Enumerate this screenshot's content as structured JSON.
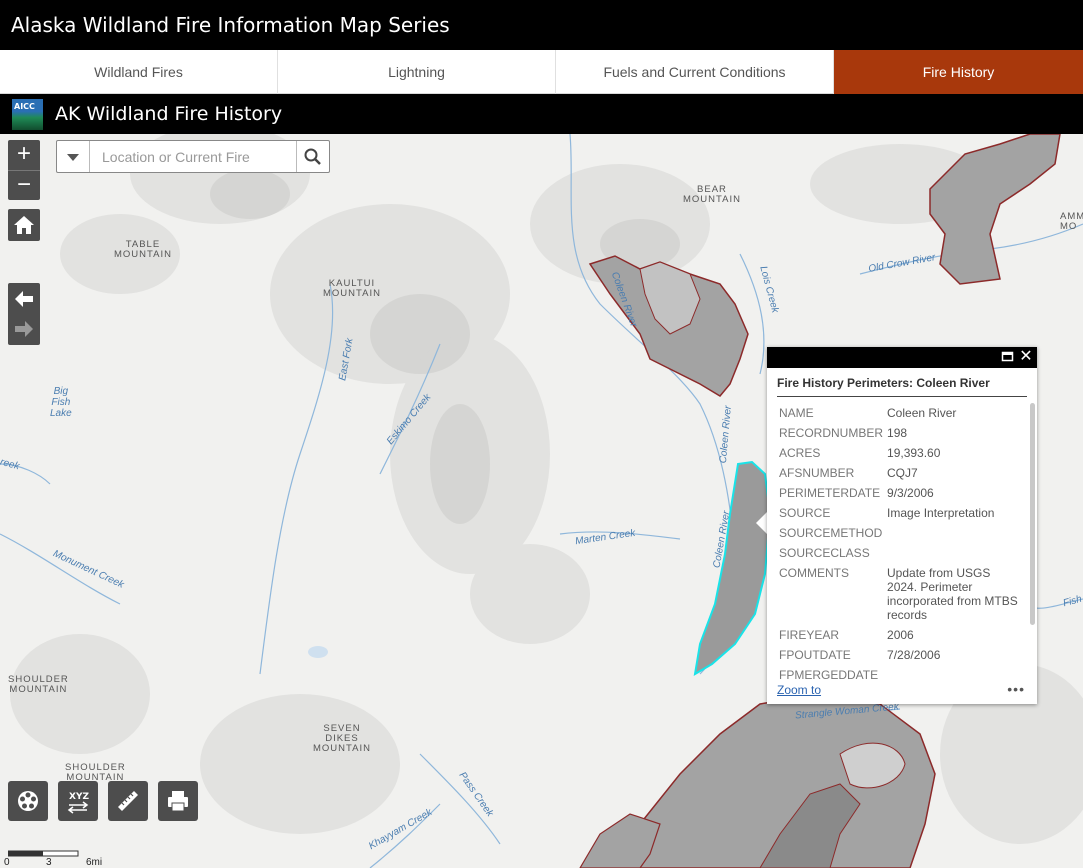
{
  "header": {
    "title": "Alaska Wildland Fire Information Map Series"
  },
  "tabs": [
    {
      "label": "Wildland Fires",
      "active": false
    },
    {
      "label": "Lightning",
      "active": false
    },
    {
      "label": "Fuels and Current Conditions",
      "active": false
    },
    {
      "label": "Fire History",
      "active": true
    }
  ],
  "app": {
    "logo_text": "AICC",
    "title": "AK Wildland Fire History"
  },
  "search": {
    "placeholder": "Location or Current Fire",
    "value": ""
  },
  "zoom": {
    "in": "+",
    "out": "−"
  },
  "map_labels": {
    "bear_mountain": [
      "BEAR",
      "MOUNTAIN"
    ],
    "table_mountain": [
      "TABLE",
      "MOUNTAIN"
    ],
    "kaultui_mountain": [
      "KAULTUI",
      "MOUNTAIN"
    ],
    "shoulder_mountain_1": [
      "SHOULDER",
      "MOUNTAIN"
    ],
    "shoulder_mountain_2": [
      "SHOULDER",
      "MOUNTAIN"
    ],
    "seven_dikes_mountain": [
      "SEVEN",
      "DIKES",
      "MOUNTAIN"
    ],
    "big_fish_lake": [
      "Big",
      "Fish",
      "Lake"
    ],
    "am_mo": [
      "AMM",
      "MO"
    ],
    "water": {
      "old_crow_river": "Old Crow River",
      "lois_creek": "Lois Creek",
      "coleen_river_1": "Coleen River",
      "coleen_river_2": "Coleen River",
      "coleen_river_3": "Coleen River",
      "east_fork": "East Fork",
      "eskimo_creek": "Eskimo Creek",
      "marten_creek": "Marten Creek",
      "monument_creek": "Monument Creek",
      "pass_creek": "Pass Creek",
      "khayyam_creek": "Khayyam Creek",
      "strangle_woman_creek": "Strangle Woman Creek",
      "fish": "Fish",
      "creek_left": "reek"
    }
  },
  "scale": {
    "ticks": [
      "0",
      "3",
      "6mi"
    ]
  },
  "popup": {
    "title": "Fire History Perimeters: Coleen River",
    "fields": [
      {
        "key": "NAME",
        "value": "Coleen River"
      },
      {
        "key": "RECORDNUMBER",
        "value": "198"
      },
      {
        "key": "ACRES",
        "value": "19,393.60"
      },
      {
        "key": "AFSNUMBER",
        "value": "CQJ7"
      },
      {
        "key": "PERIMETERDATE",
        "value": "9/3/2006"
      },
      {
        "key": "SOURCE",
        "value": "Image Interpretation"
      },
      {
        "key": "SOURCEMETHOD",
        "value": ""
      },
      {
        "key": "SOURCECLASS",
        "value": ""
      },
      {
        "key": "COMMENTS",
        "value": "Update from USGS 2024. Perimeter incorporated from MTBS records"
      },
      {
        "key": "FIREYEAR",
        "value": "2006"
      },
      {
        "key": "FPOUTDATE",
        "value": "7/28/2006"
      },
      {
        "key": "FPMERGEDDATE",
        "value": ""
      }
    ],
    "zoom_to": "Zoom to",
    "more": "•••"
  },
  "colors": {
    "title_bg": "#000000",
    "active_tab": "#a8380c",
    "fire_fill": "#9a9a9a",
    "fire_stroke": "#8c2a2a",
    "selected_stroke": "#19e3e8",
    "water": "#8fb7db"
  }
}
